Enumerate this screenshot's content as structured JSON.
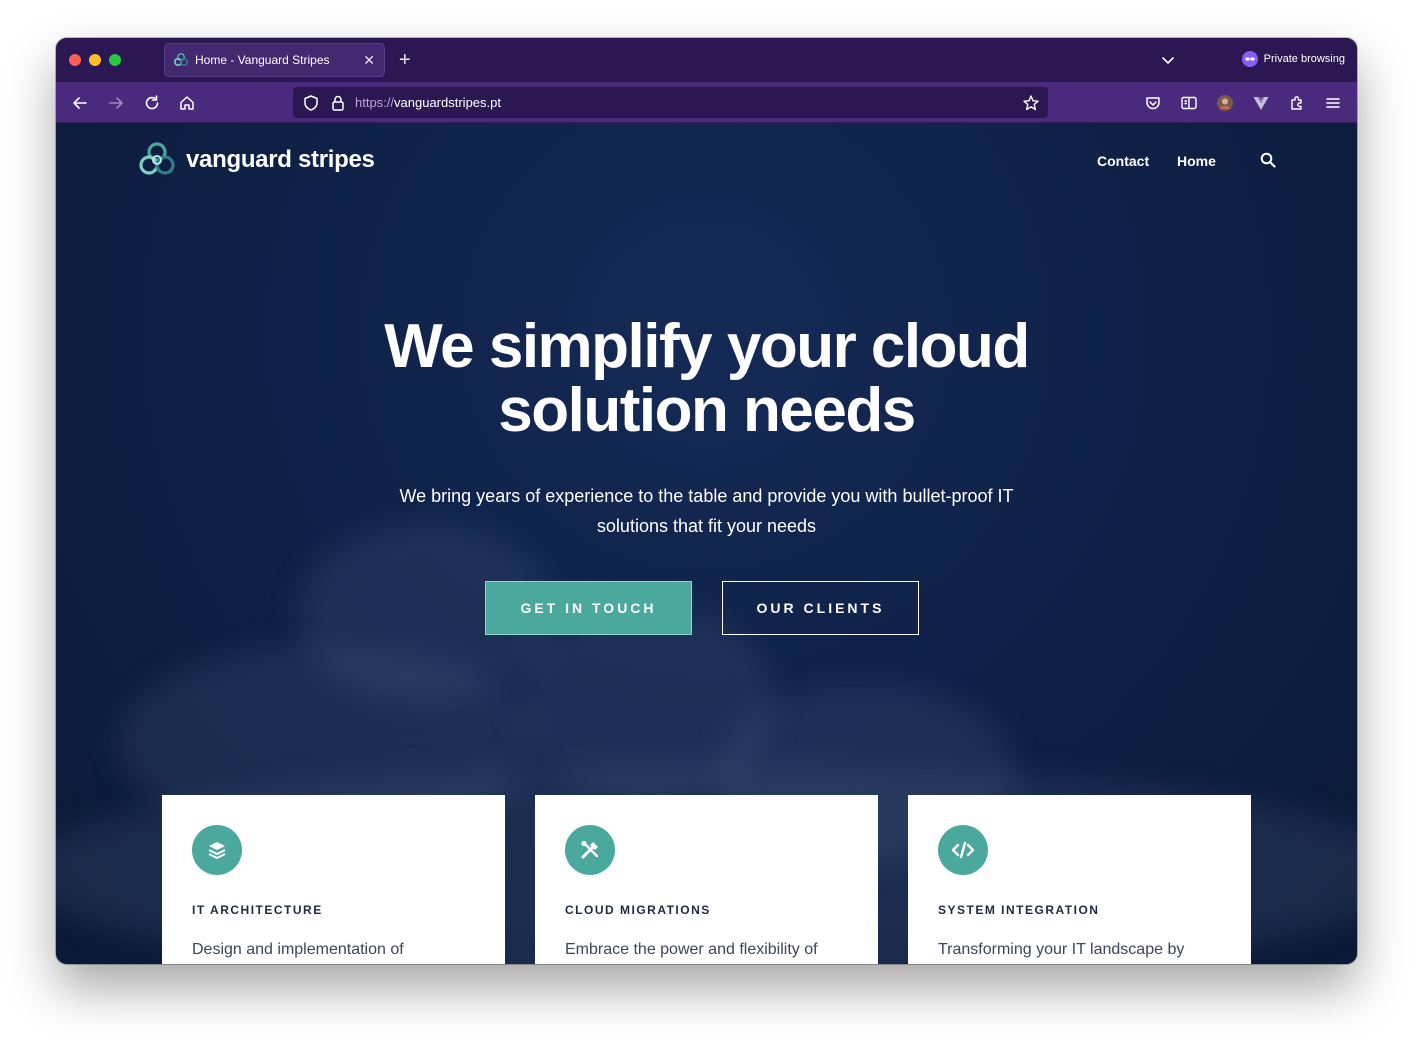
{
  "browser": {
    "tab_title": "Home - Vanguard Stripes",
    "private_label": "Private browsing",
    "url_scheme": "https://",
    "url_host": "vanguardstripes.pt"
  },
  "site": {
    "logo_text": "vanguard stripes",
    "nav": {
      "contact": "Contact",
      "home": "Home"
    }
  },
  "hero": {
    "title_line1": "We simplify your cloud",
    "title_line2": "solution needs",
    "subtitle": "We bring years of experience to the table and provide you with bullet-proof IT solutions that fit your needs",
    "cta_primary": "GET IN TOUCH",
    "cta_secondary": "OUR CLIENTS"
  },
  "services": [
    {
      "icon": "layers-icon",
      "title": "IT ARCHITECTURE",
      "text": "Design and implementation of"
    },
    {
      "icon": "tools-icon",
      "title": "CLOUD MIGRATIONS",
      "text": "Embrace the power and flexibility of"
    },
    {
      "icon": "code-icon",
      "title": "SYSTEM INTEGRATION",
      "text": "Transforming your IT landscape by"
    }
  ],
  "colors": {
    "accent": "#4aa89c",
    "hero_bg": "#0f2148",
    "browser_tabbar": "#2b1852",
    "browser_toolbar": "#4a2a7c"
  }
}
